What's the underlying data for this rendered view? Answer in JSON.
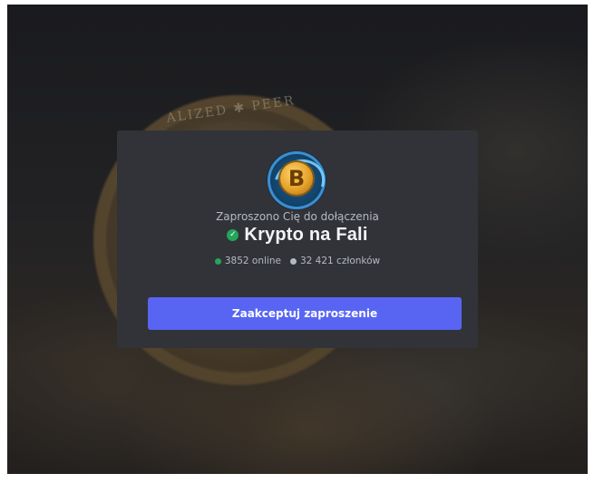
{
  "invite": {
    "invited_text": "Zaproszono Cię do dołączenia",
    "server_name": "Krypto na Fali",
    "server_icon": "bitcoin-wave-server-icon",
    "verified_icon": "verified-check-icon",
    "online_count": "3852 online",
    "member_count": "32 421 członków",
    "accept_label": "Zaakceptuj zaproszenie"
  },
  "background": {
    "coin_text": "ALIZED ✱ PEER"
  },
  "colors": {
    "card_bg": "#313338",
    "button": "#5865f2",
    "online_dot": "#23a55a",
    "members_dot": "#b5bac1"
  }
}
